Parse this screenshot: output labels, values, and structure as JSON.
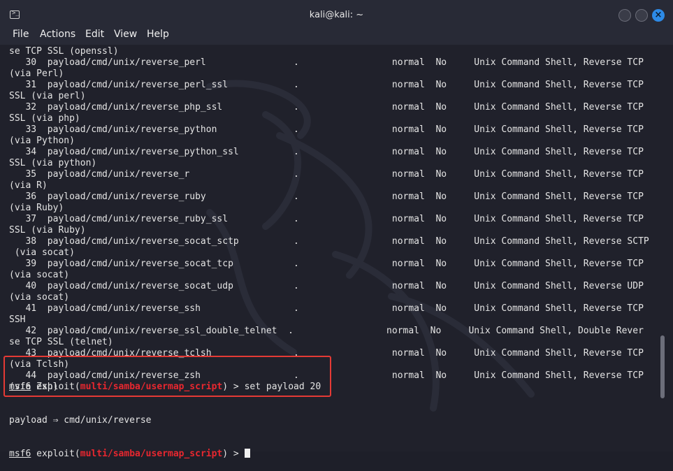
{
  "window": {
    "title": "kali@kali: ~"
  },
  "menu": [
    "File",
    "Actions",
    "Edit",
    "View",
    "Help"
  ],
  "output_lines": [
    "se TCP SSL (openssl)",
    "   30  payload/cmd/unix/reverse_perl                .                 normal  No     Unix Command Shell, Reverse TCP",
    "(via Perl)",
    "   31  payload/cmd/unix/reverse_perl_ssl            .                 normal  No     Unix Command Shell, Reverse TCP",
    "SSL (via perl)",
    "   32  payload/cmd/unix/reverse_php_ssl             .                 normal  No     Unix Command Shell, Reverse TCP",
    "SSL (via php)",
    "   33  payload/cmd/unix/reverse_python              .                 normal  No     Unix Command Shell, Reverse TCP",
    "(via Python)",
    "   34  payload/cmd/unix/reverse_python_ssl          .                 normal  No     Unix Command Shell, Reverse TCP",
    "SSL (via python)",
    "   35  payload/cmd/unix/reverse_r                   .                 normal  No     Unix Command Shell, Reverse TCP",
    "(via R)",
    "   36  payload/cmd/unix/reverse_ruby                .                 normal  No     Unix Command Shell, Reverse TCP",
    "(via Ruby)",
    "   37  payload/cmd/unix/reverse_ruby_ssl            .                 normal  No     Unix Command Shell, Reverse TCP",
    "SSL (via Ruby)",
    "   38  payload/cmd/unix/reverse_socat_sctp          .                 normal  No     Unix Command Shell, Reverse SCTP",
    " (via socat)",
    "   39  payload/cmd/unix/reverse_socat_tcp           .                 normal  No     Unix Command Shell, Reverse TCP",
    "(via socat)",
    "   40  payload/cmd/unix/reverse_socat_udp           .                 normal  No     Unix Command Shell, Reverse UDP",
    "(via socat)",
    "   41  payload/cmd/unix/reverse_ssh                 .                 normal  No     Unix Command Shell, Reverse TCP",
    "SSH",
    "   42  payload/cmd/unix/reverse_ssl_double_telnet  .                 normal  No     Unix Command Shell, Double Rever",
    "se TCP SSL (telnet)",
    "   43  payload/cmd/unix/reverse_tclsh               .                 normal  No     Unix Command Shell, Reverse TCP",
    "(via Tclsh)",
    "   44  payload/cmd/unix/reverse_zsh                 .                 normal  No     Unix Command Shell, Reverse TCP",
    "(via Zsh)"
  ],
  "prompt": {
    "msf": "msf6",
    "exploit_word": " exploit(",
    "module": "multi/samba/usermap_script",
    "close": ") > ",
    "command": "set payload 20",
    "response": "payload ⇒ cmd/unix/reverse"
  },
  "colors": {
    "module": "#e8272f",
    "highlight_box": "#e53a35",
    "close_button": "#2d8ae6"
  }
}
